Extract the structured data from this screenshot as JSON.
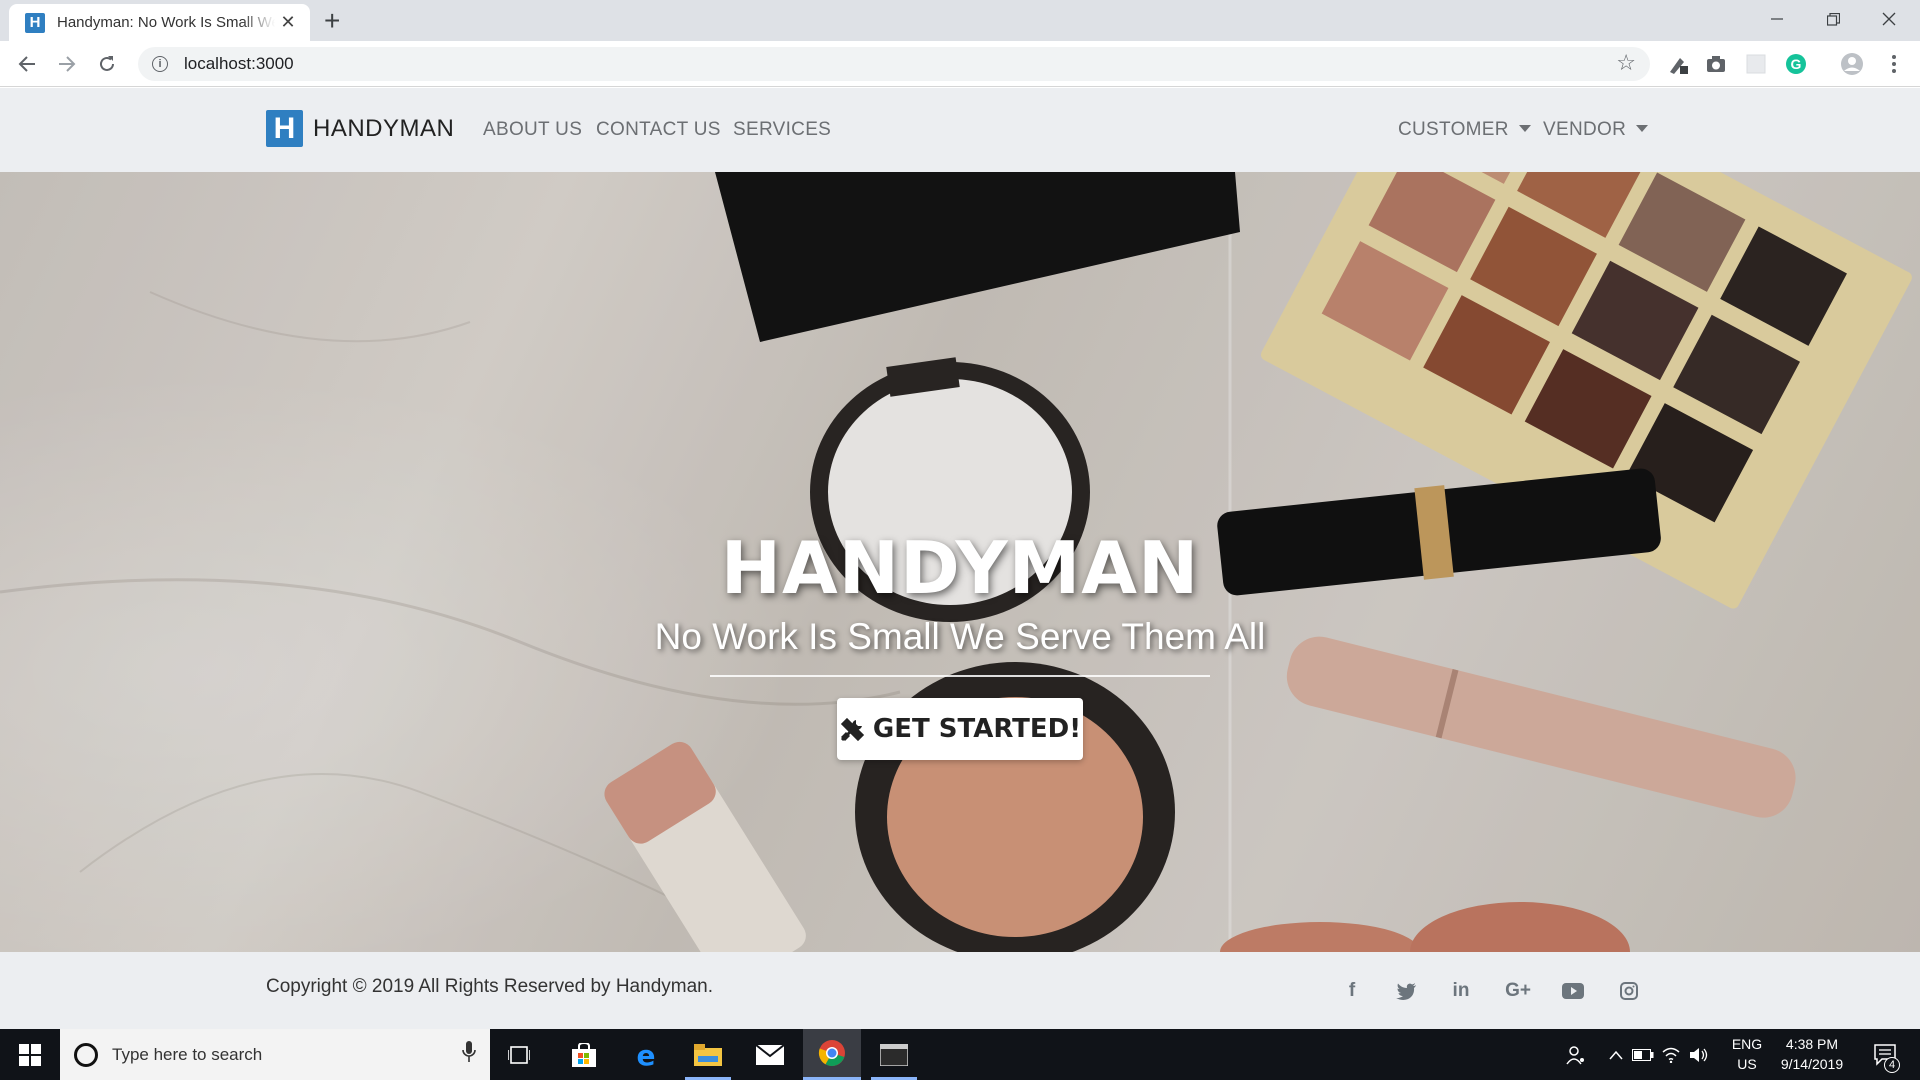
{
  "browser": {
    "tab_title": "Handyman: No Work Is Small We Serve Them All",
    "tab_favicon": "H",
    "url": "localhost:3000",
    "icons": [
      "back-icon",
      "forward-icon",
      "reload-icon",
      "info-icon",
      "star-icon",
      "minimize-icon",
      "restore-icon",
      "close-icon",
      "new-tab-icon",
      "menu-icon"
    ]
  },
  "navbar": {
    "brand_logo": "H",
    "brand_text": "HANDYMAN",
    "links": [
      "ABOUT US",
      "CONTACT US",
      "SERVICES"
    ],
    "dropdowns": [
      "CUSTOMER",
      "VENDOR"
    ]
  },
  "hero": {
    "title": "HANDYMAN",
    "subtitle": "No Work Is Small We Serve Them All",
    "button_label": "GET STARTED!"
  },
  "footer": {
    "copyright": "Copyright © 2019 All Rights Reserved by Handyman.",
    "social": [
      "f",
      "t",
      "in",
      "G+",
      "▶",
      "◎"
    ]
  },
  "taskbar": {
    "search_placeholder": "Type here to search",
    "lang_line1": "ENG",
    "lang_line2": "US",
    "time": "4:38 PM",
    "date": "9/14/2019",
    "notification_count": "4"
  },
  "colors": {
    "brand": "#2f7fc1",
    "navbar_bg": "#eceef1",
    "taskbar_bg": "#101318"
  }
}
